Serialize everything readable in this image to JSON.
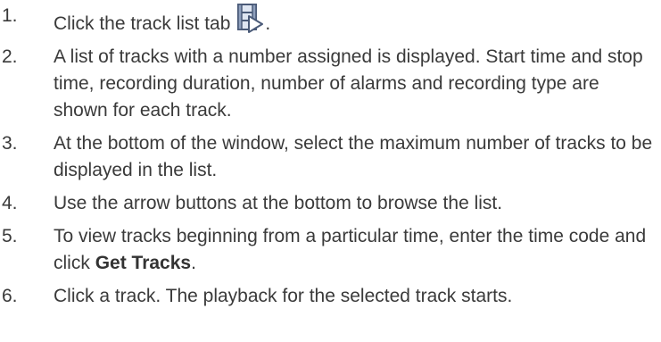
{
  "steps": [
    {
      "number": "1.",
      "text_before": "Click the track list tab",
      "text_after": ".",
      "icon": "track-list-tab-icon"
    },
    {
      "number": "2.",
      "text": "A list of tracks with a number assigned is displayed. Start time and stop time, recording duration, number of alarms and recording type are shown for each track."
    },
    {
      "number": "3.",
      "text": "At the bottom of the window, select the maximum number of tracks to be displayed in the list."
    },
    {
      "number": "4.",
      "text": "Use the arrow buttons at the bottom to browse the list."
    },
    {
      "number": "5.",
      "text_before": "To view tracks beginning from a particular time, enter the time code and click",
      "bold": "Get Tracks",
      "text_after": "."
    },
    {
      "number": "6.",
      "text": "Click a track. The playback for the selected track starts."
    }
  ],
  "colors": {
    "text": "#3a3a3a",
    "icon_frame": "#4a5a78",
    "icon_fill": "#dfe6f2",
    "icon_play": "#ffffff"
  }
}
